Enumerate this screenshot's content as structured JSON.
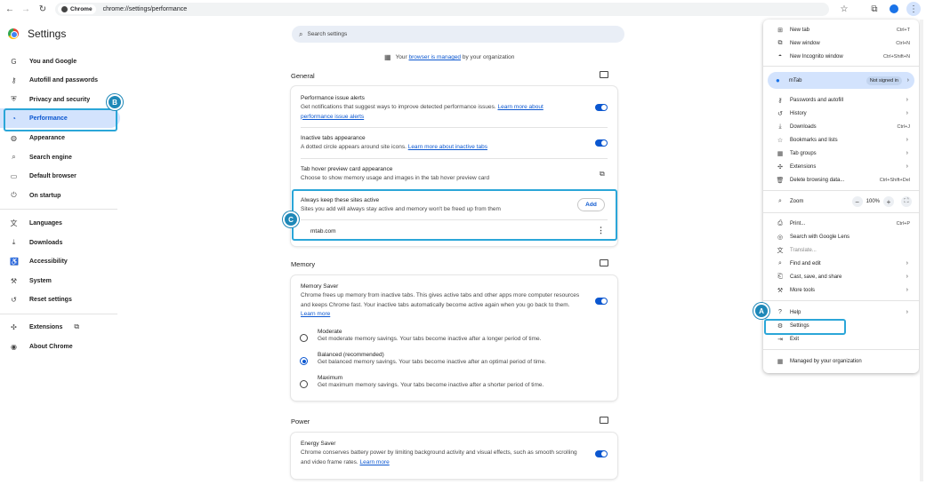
{
  "browser": {
    "chip_label": "Chrome",
    "url": "chrome://settings/performance"
  },
  "sidebar": {
    "title": "Settings",
    "items": [
      {
        "label": "You and Google",
        "icon": "google-g-icon"
      },
      {
        "label": "Autofill and passwords",
        "icon": "key-icon"
      },
      {
        "label": "Privacy and security",
        "icon": "shield-icon"
      },
      {
        "label": "Performance",
        "icon": "speedometer-icon"
      },
      {
        "label": "Appearance",
        "icon": "palette-icon"
      },
      {
        "label": "Search engine",
        "icon": "search-icon"
      },
      {
        "label": "Default browser",
        "icon": "browser-window-icon"
      },
      {
        "label": "On startup",
        "icon": "power-icon"
      },
      {
        "label": "Languages",
        "icon": "translate-icon"
      },
      {
        "label": "Downloads",
        "icon": "download-icon"
      },
      {
        "label": "Accessibility",
        "icon": "accessibility-icon"
      },
      {
        "label": "System",
        "icon": "wrench-icon"
      },
      {
        "label": "Reset settings",
        "icon": "reset-icon"
      },
      {
        "label": "Extensions",
        "icon": "puzzle-icon"
      },
      {
        "label": "About Chrome",
        "icon": "chrome-icon"
      }
    ]
  },
  "search": {
    "placeholder": "Search settings"
  },
  "managed": {
    "prefix": "Your",
    "link": "browser is managed",
    "suffix": "by your organization"
  },
  "general": {
    "heading": "General",
    "perf_alerts": {
      "title": "Performance issue alerts",
      "desc": "Get notifications that suggest ways to improve detected performance issues.",
      "link": "Learn more about performance issue alerts"
    },
    "inactive_tabs": {
      "title": "Inactive tabs appearance",
      "desc": "A dotted circle appears around site icons.",
      "link": "Learn more about inactive tabs"
    },
    "hover_preview": {
      "title": "Tab hover preview card appearance",
      "desc": "Choose to show memory usage and images in the tab hover preview card"
    },
    "keep_active": {
      "title": "Always keep these sites active",
      "desc": "Sites you add will always stay active and memory won't be freed up from them",
      "add_label": "Add",
      "site": "mtab.com"
    }
  },
  "memory": {
    "heading": "Memory",
    "saver_title": "Memory Saver",
    "saver_desc": "Chrome frees up memory from inactive tabs. This gives active tabs and other apps more computer resources and keeps Chrome fast. Your inactive tabs automatically become active again when you go back to them.",
    "saver_link": "Learn more",
    "options": [
      {
        "title": "Moderate",
        "desc": "Get moderate memory savings. Your tabs become inactive after a longer period of time.",
        "selected": false
      },
      {
        "title": "Balanced (recommended)",
        "desc": "Get balanced memory savings. Your tabs become inactive after an optimal period of time.",
        "selected": true
      },
      {
        "title": "Maximum",
        "desc": "Get maximum memory savings. Your tabs become inactive after a shorter period of time.",
        "selected": false
      }
    ]
  },
  "power": {
    "heading": "Power",
    "saver_title": "Energy Saver",
    "saver_desc": "Chrome conserves battery power by limiting background activity and visual effects, such as smooth scrolling and video frame rates.",
    "saver_link": "Learn more"
  },
  "menu": {
    "new_tab": {
      "label": "New tab",
      "shortcut": "Ctrl+T"
    },
    "new_window": {
      "label": "New window",
      "shortcut": "Ctrl+N"
    },
    "incognito": {
      "label": "New Incognito window",
      "shortcut": "Ctrl+Shift+N"
    },
    "profile": {
      "name": "mTab",
      "status": "Not signed in"
    },
    "passwords": {
      "label": "Passwords and autofill"
    },
    "history": {
      "label": "History"
    },
    "downloads": {
      "label": "Downloads",
      "shortcut": "Ctrl+J"
    },
    "bookmarks": {
      "label": "Bookmarks and lists"
    },
    "tab_groups": {
      "label": "Tab groups"
    },
    "extensions": {
      "label": "Extensions"
    },
    "delete_data": {
      "label": "Delete browsing data...",
      "shortcut": "Ctrl+Shift+Del"
    },
    "zoom": {
      "label": "Zoom",
      "minus": "−",
      "level": "100%",
      "plus": "+"
    },
    "print": {
      "label": "Print...",
      "shortcut": "Ctrl+P"
    },
    "lens": {
      "label": "Search with Google Lens"
    },
    "translate": {
      "label": "Translate..."
    },
    "find_edit": {
      "label": "Find and edit"
    },
    "cast_save": {
      "label": "Cast, save, and share"
    },
    "more_tools": {
      "label": "More tools"
    },
    "help": {
      "label": "Help"
    },
    "settings": {
      "label": "Settings"
    },
    "exit": {
      "label": "Exit"
    },
    "managed": {
      "label": "Managed by your organization"
    }
  },
  "callouts": {
    "a": "A",
    "b": "B",
    "c": "C"
  },
  "colors": {
    "accent": "#0b57d0",
    "callout": "#2ba6d8",
    "active_bg": "#d3e3fd"
  }
}
